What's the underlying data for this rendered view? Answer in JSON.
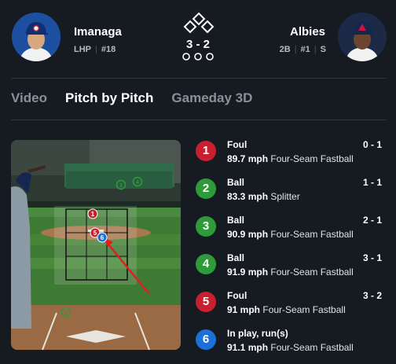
{
  "matchup": {
    "pitcher": {
      "name": "Imanaga",
      "position": "LHP",
      "number": "#18"
    },
    "batter": {
      "name": "Albies",
      "position": "2B",
      "number": "#1",
      "bats": "S"
    },
    "count": "3 - 2"
  },
  "tabs": [
    {
      "label": "Video",
      "active": false
    },
    {
      "label": "Pitch by Pitch",
      "active": true
    },
    {
      "label": "Gameday 3D",
      "active": false
    }
  ],
  "video": {
    "zone_markers": [
      "1",
      "5",
      "6"
    ],
    "outside_markers": [
      "2",
      "3",
      "4"
    ]
  },
  "pitches": [
    {
      "number": "1",
      "result": "Foul",
      "count": "0 - 1",
      "speed": "89.7 mph",
      "type": "Four-Seam Fastball",
      "color": "#c8202f"
    },
    {
      "number": "2",
      "result": "Ball",
      "count": "1 - 1",
      "speed": "83.3 mph",
      "type": "Splitter",
      "color": "#2e9b3a"
    },
    {
      "number": "3",
      "result": "Ball",
      "count": "2 - 1",
      "speed": "90.9 mph",
      "type": "Four-Seam Fastball",
      "color": "#2e9b3a"
    },
    {
      "number": "4",
      "result": "Ball",
      "count": "3 - 1",
      "speed": "91.9 mph",
      "type": "Four-Seam Fastball",
      "color": "#2e9b3a"
    },
    {
      "number": "5",
      "result": "Foul",
      "count": "3 - 2",
      "speed": "91 mph",
      "type": "Four-Seam Fastball",
      "color": "#c8202f"
    },
    {
      "number": "6",
      "result": "In play, run(s)",
      "count": "",
      "speed": "91.1 mph",
      "type": "Four-Seam Fastball",
      "color": "#1b6fd8"
    }
  ]
}
